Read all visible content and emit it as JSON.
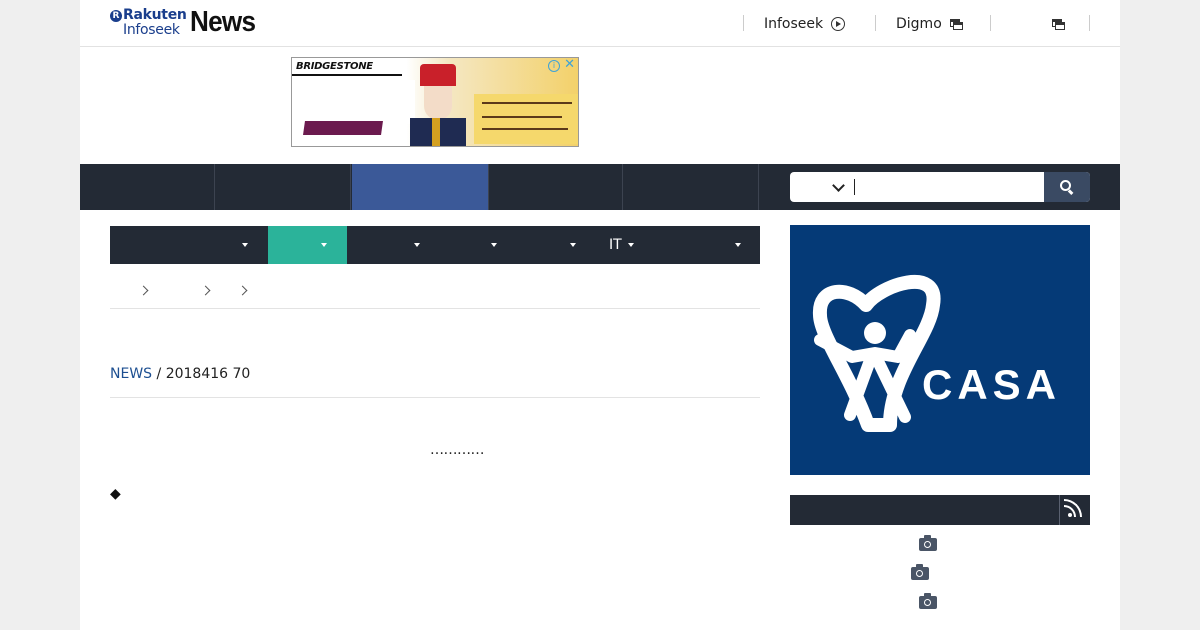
{
  "header": {
    "logo": {
      "badge": "R",
      "line1": "Rakuten",
      "line2": "Infoseek",
      "wordmark": "News"
    },
    "links": [
      {
        "label": "Infoseek",
        "icon": "circle-arrow-icon"
      },
      {
        "label": "Digmo",
        "icon": "external-window-icon"
      },
      {
        "label": "",
        "icon": "external-window-icon"
      }
    ]
  },
  "ad_banner": {
    "brand": "BRIDGESTONE",
    "info_icon": "i",
    "close_icon": "✕",
    "colors": {
      "accent": "#3da3d8",
      "hat": "#c9202a",
      "band": "#6b1a4e",
      "gold": "#f3d16a"
    }
  },
  "main_nav": {
    "items": [
      "",
      "",
      "",
      "",
      ""
    ],
    "active_index": 2,
    "colors": {
      "bg": "#232a35",
      "active": "#3b5998"
    }
  },
  "search": {
    "category_value": "",
    "query_value": "",
    "button_icon": "search-icon"
  },
  "sub_nav": {
    "items": [
      {
        "label": ""
      },
      {
        "label": ""
      },
      {
        "label": ""
      },
      {
        "label": ""
      },
      {
        "label": ""
      },
      {
        "label": "IT"
      },
      {
        "label": ""
      }
    ],
    "active_index": 1,
    "colors": {
      "bg": "#232a35",
      "active": "#2bb39a"
    }
  },
  "breadcrumb": {
    "items": [
      "",
      "",
      "",
      ""
    ]
  },
  "article": {
    "source": "NEWS",
    "separator": "/",
    "date_info": "2018416 70",
    "ellipsis": "…………",
    "bullet": "◆"
  },
  "sidebar": {
    "ad": {
      "registered_mark": "®",
      "wordmark": "CASA",
      "bg": "#053a77"
    },
    "ranking": {
      "title": "",
      "rss_icon": "rss-icon",
      "items": [
        {
          "text": "",
          "icon": "camera-icon"
        },
        {
          "text": "",
          "icon": "camera-icon"
        },
        {
          "text": "",
          "icon": "camera-icon"
        }
      ]
    }
  }
}
